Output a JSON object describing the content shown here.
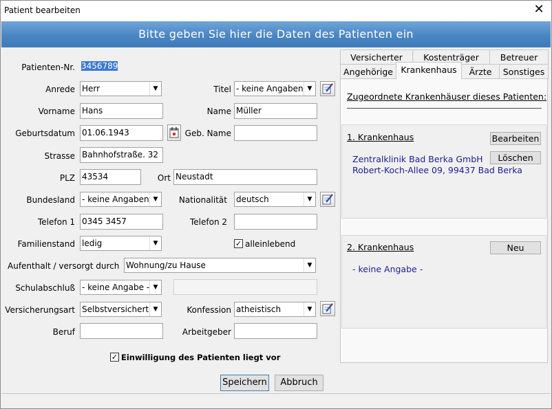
{
  "window": {
    "title": "Patient bearbeiten",
    "close": "✕"
  },
  "banner": "Bitte geben Sie hier die Daten des Patienten ein",
  "form": {
    "patient_nr": {
      "label": "Patienten-Nr.",
      "value": "3456789"
    },
    "anrede": {
      "label": "Anrede",
      "value": "Herr"
    },
    "titel": {
      "label": "Titel",
      "value": "- keine Angaben -"
    },
    "vorname": {
      "label": "Vorname",
      "value": "Hans"
    },
    "name": {
      "label": "Name",
      "value": "Müller"
    },
    "geburtsdatum": {
      "label": "Geburtsdatum",
      "value": "01.06.1943"
    },
    "geb_name": {
      "label": "Geb. Name",
      "value": ""
    },
    "strasse": {
      "label": "Strasse",
      "value": "Bahnhofstraße. 32"
    },
    "plz": {
      "label": "PLZ",
      "value": "43534"
    },
    "ort": {
      "label": "Ort",
      "value": "Neustadt"
    },
    "bundesland": {
      "label": "Bundesland",
      "value": "- keine Angaben -"
    },
    "nationalitaet": {
      "label": "Nationalität",
      "value": "deutsch"
    },
    "telefon1": {
      "label": "Telefon 1",
      "value": "0345 3457"
    },
    "telefon2": {
      "label": "Telefon 2",
      "value": ""
    },
    "familienstand": {
      "label": "Familienstand",
      "value": "ledig"
    },
    "alleinlebend": {
      "label": "alleinlebend",
      "checked": true
    },
    "aufenthalt": {
      "label": "Aufenthalt / versorgt durch",
      "value": "Wohnung/zu Hause"
    },
    "schulabschluss": {
      "label": "Schulabschluß",
      "value": "- keine Angabe -"
    },
    "versicherungsart": {
      "label": "Versicherungsart",
      "value": "Selbstversichert"
    },
    "konfession": {
      "label": "Konfession",
      "value": "atheistisch"
    },
    "beruf": {
      "label": "Beruf",
      "value": ""
    },
    "arbeitgeber": {
      "label": "Arbeitgeber",
      "value": ""
    },
    "einwilligung": {
      "label": "Einwilligung des Patienten liegt vor",
      "checked": true
    }
  },
  "buttons": {
    "save": "Speichern",
    "cancel": "Abbruch"
  },
  "tabs": {
    "row1": [
      "Versicherter",
      "Kostenträger",
      "Betreuer"
    ],
    "row2": [
      "Angehörige",
      "Krankenhaus",
      "Ärzte",
      "Sonstiges"
    ],
    "active": "Krankenhaus"
  },
  "krankenhaus": {
    "heading": "Zugeordnete Krankenhäuser dieses Patienten:",
    "first": {
      "title": "1. Krankenhaus",
      "name": "Zentralklinik Bad Berka GmbH",
      "address": "Robert-Koch-Allee 09, 99437 Bad Berka",
      "edit_label": "Bearbeiten",
      "delete_label": "Löschen"
    },
    "second": {
      "title": "2. Krankenhaus",
      "empty": "- keine Angabe -",
      "new_label": "Neu"
    }
  },
  "icons": {
    "dropdown": "▼",
    "check": "✓"
  }
}
